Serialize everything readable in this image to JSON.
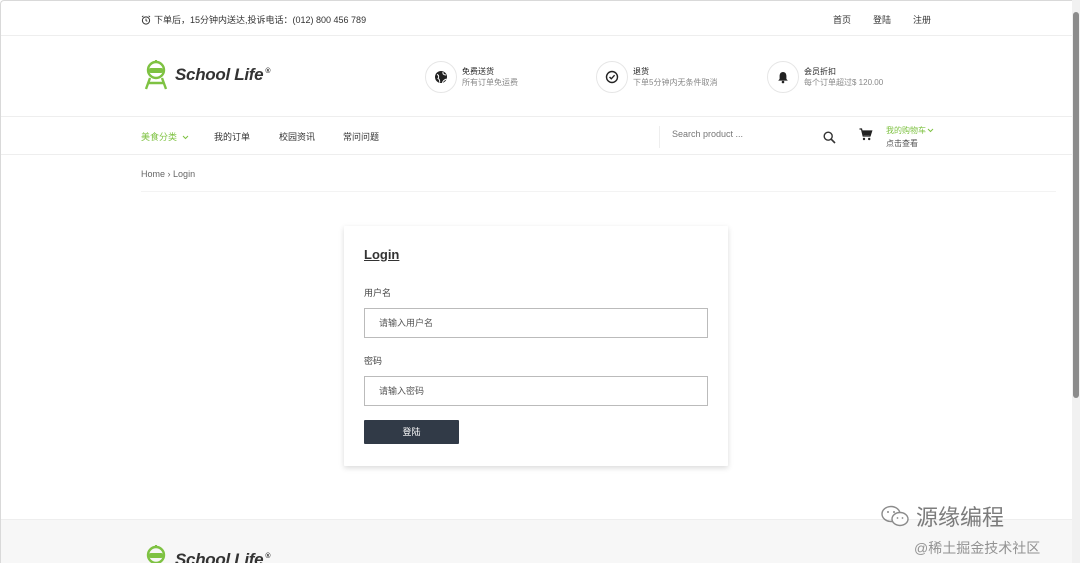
{
  "topbar": {
    "notice": "下单后，15分钟内送达,投诉电话：(012) 800 456 789",
    "links": [
      "首页",
      "登陆",
      "注册"
    ]
  },
  "logo": {
    "text": "School Life",
    "mark": "®"
  },
  "features": [
    {
      "icon": "globe-icon",
      "title": "免费送货",
      "sub": "所有订单免运费"
    },
    {
      "icon": "check-circle-icon",
      "title": "退货",
      "sub": "下单5分钟内无条件取消"
    },
    {
      "icon": "bell-icon",
      "title": "会员折扣",
      "sub": "每个订单超过$ 120.00"
    }
  ],
  "nav": {
    "items": [
      "美食分类",
      "我的订单",
      "校园资讯",
      "常问问题"
    ],
    "search_placeholder": "Search product ...",
    "cart_title": "我的购物车",
    "cart_sub": "点击查看"
  },
  "breadcrumb": {
    "home": "Home",
    "sep": "›",
    "current": "Login"
  },
  "login": {
    "title": "Login",
    "username_label": "用户名",
    "username_placeholder": "请输入用户名",
    "password_label": "密码",
    "password_placeholder": "请输入密码",
    "submit": "登陆"
  },
  "watermark": {
    "main": "源缘编程",
    "sub": "@稀土掘金技术社区"
  },
  "colors": {
    "accent": "#7ec242",
    "button": "#313a47"
  }
}
